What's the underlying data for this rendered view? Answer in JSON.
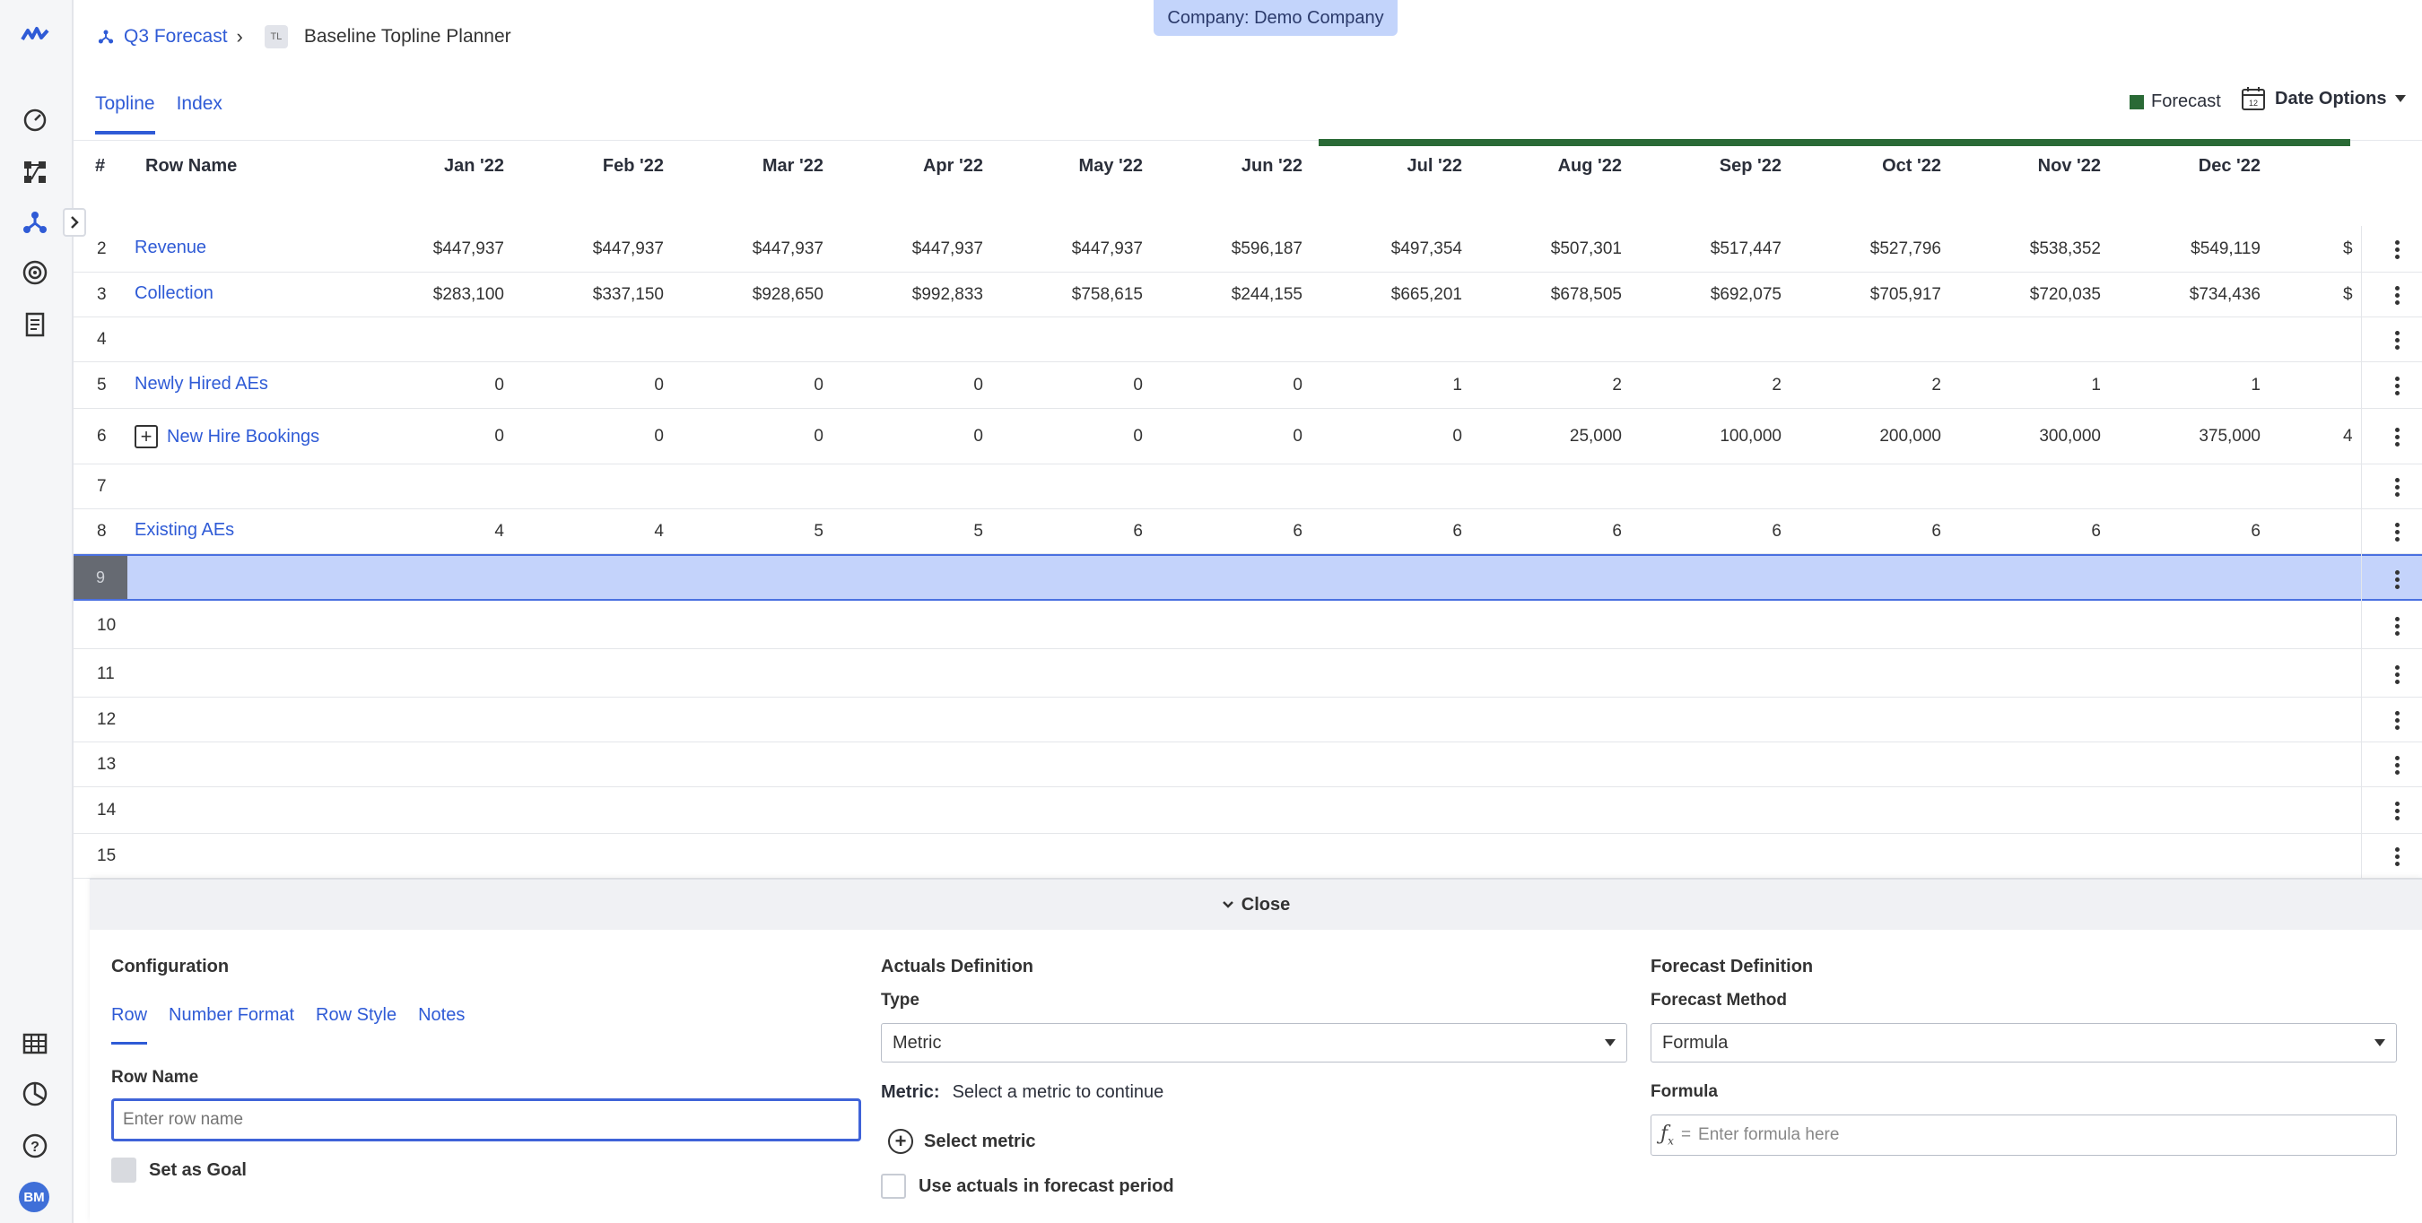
{
  "breadcrumb": {
    "parent": "Q3 Forecast",
    "badge": "TL",
    "current": "Baseline Topline Planner"
  },
  "company_label": "Company: Demo Company",
  "tabs": [
    {
      "label": "Topline",
      "active": true
    },
    {
      "label": "Index",
      "active": false
    }
  ],
  "legend": {
    "label": "Forecast",
    "color": "#2a6a36"
  },
  "date_options": {
    "label": "Date Options",
    "icon_day": "12"
  },
  "grid": {
    "header_num": "#",
    "header_name": "Row Name",
    "months": [
      "Jan '22",
      "Feb '22",
      "Mar '22",
      "Apr '22",
      "May '22",
      "Jun '22",
      "Jul '22",
      "Aug '22",
      "Sep '22",
      "Oct '22",
      "Nov '22",
      "Dec '22"
    ],
    "rows": [
      {
        "num": "2",
        "name": "Revenue",
        "values": [
          "$447,937",
          "$447,937",
          "$447,937",
          "$447,937",
          "$447,937",
          "$596,187",
          "$497,354",
          "$507,301",
          "$517,447",
          "$527,796",
          "$538,352",
          "$549,119"
        ],
        "overflow": "$"
      },
      {
        "num": "3",
        "name": "Collection",
        "values": [
          "$283,100",
          "$337,150",
          "$928,650",
          "$992,833",
          "$758,615",
          "$244,155",
          "$665,201",
          "$678,505",
          "$692,075",
          "$705,917",
          "$720,035",
          "$734,436"
        ],
        "overflow": "$"
      },
      {
        "num": "4",
        "name": "",
        "values": [],
        "overflow": ""
      },
      {
        "num": "5",
        "name": "Newly Hired AEs",
        "values": [
          "0",
          "0",
          "0",
          "0",
          "0",
          "0",
          "1",
          "2",
          "2",
          "2",
          "1",
          "1"
        ],
        "overflow": ""
      },
      {
        "num": "6",
        "name": "New Hire Bookings",
        "expandable": true,
        "values": [
          "0",
          "0",
          "0",
          "0",
          "0",
          "0",
          "0",
          "25,000",
          "100,000",
          "200,000",
          "300,000",
          "375,000"
        ],
        "overflow": "4"
      },
      {
        "num": "7",
        "name": "",
        "values": [],
        "overflow": ""
      },
      {
        "num": "8",
        "name": "Existing AEs",
        "values": [
          "4",
          "4",
          "5",
          "5",
          "6",
          "6",
          "6",
          "6",
          "6",
          "6",
          "6",
          "6"
        ],
        "overflow": ""
      },
      {
        "num": "9",
        "name": "",
        "values": [],
        "overflow": "",
        "selected": true
      },
      {
        "num": "10",
        "name": "",
        "values": [],
        "overflow": ""
      },
      {
        "num": "11",
        "name": "",
        "values": [],
        "overflow": ""
      },
      {
        "num": "12",
        "name": "",
        "values": [],
        "overflow": ""
      },
      {
        "num": "13",
        "name": "",
        "values": [],
        "overflow": ""
      },
      {
        "num": "14",
        "name": "",
        "values": [],
        "overflow": ""
      },
      {
        "num": "15",
        "name": "",
        "values": [],
        "overflow": ""
      }
    ]
  },
  "panel": {
    "close_label": "Close",
    "configuration": {
      "title": "Configuration",
      "tabs": [
        {
          "label": "Row",
          "active": true
        },
        {
          "label": "Number Format",
          "active": false
        },
        {
          "label": "Row Style",
          "active": false
        },
        {
          "label": "Notes",
          "active": false
        }
      ],
      "row_name_label": "Row Name",
      "row_name_placeholder": "Enter row name",
      "row_name_value": "",
      "goal_label": "Set as Goal"
    },
    "actuals": {
      "title": "Actuals Definition",
      "type_label": "Type",
      "type_value": "Metric",
      "metric_label": "Metric:",
      "metric_hint": "Select a metric to continue",
      "select_metric_label": "Select metric",
      "use_actuals_label": "Use actuals in forecast period"
    },
    "forecast": {
      "title": "Forecast Definition",
      "method_label": "Forecast Method",
      "method_value": "Formula",
      "formula_label": "Formula",
      "formula_eq": "=",
      "formula_placeholder": "Enter formula here"
    }
  }
}
